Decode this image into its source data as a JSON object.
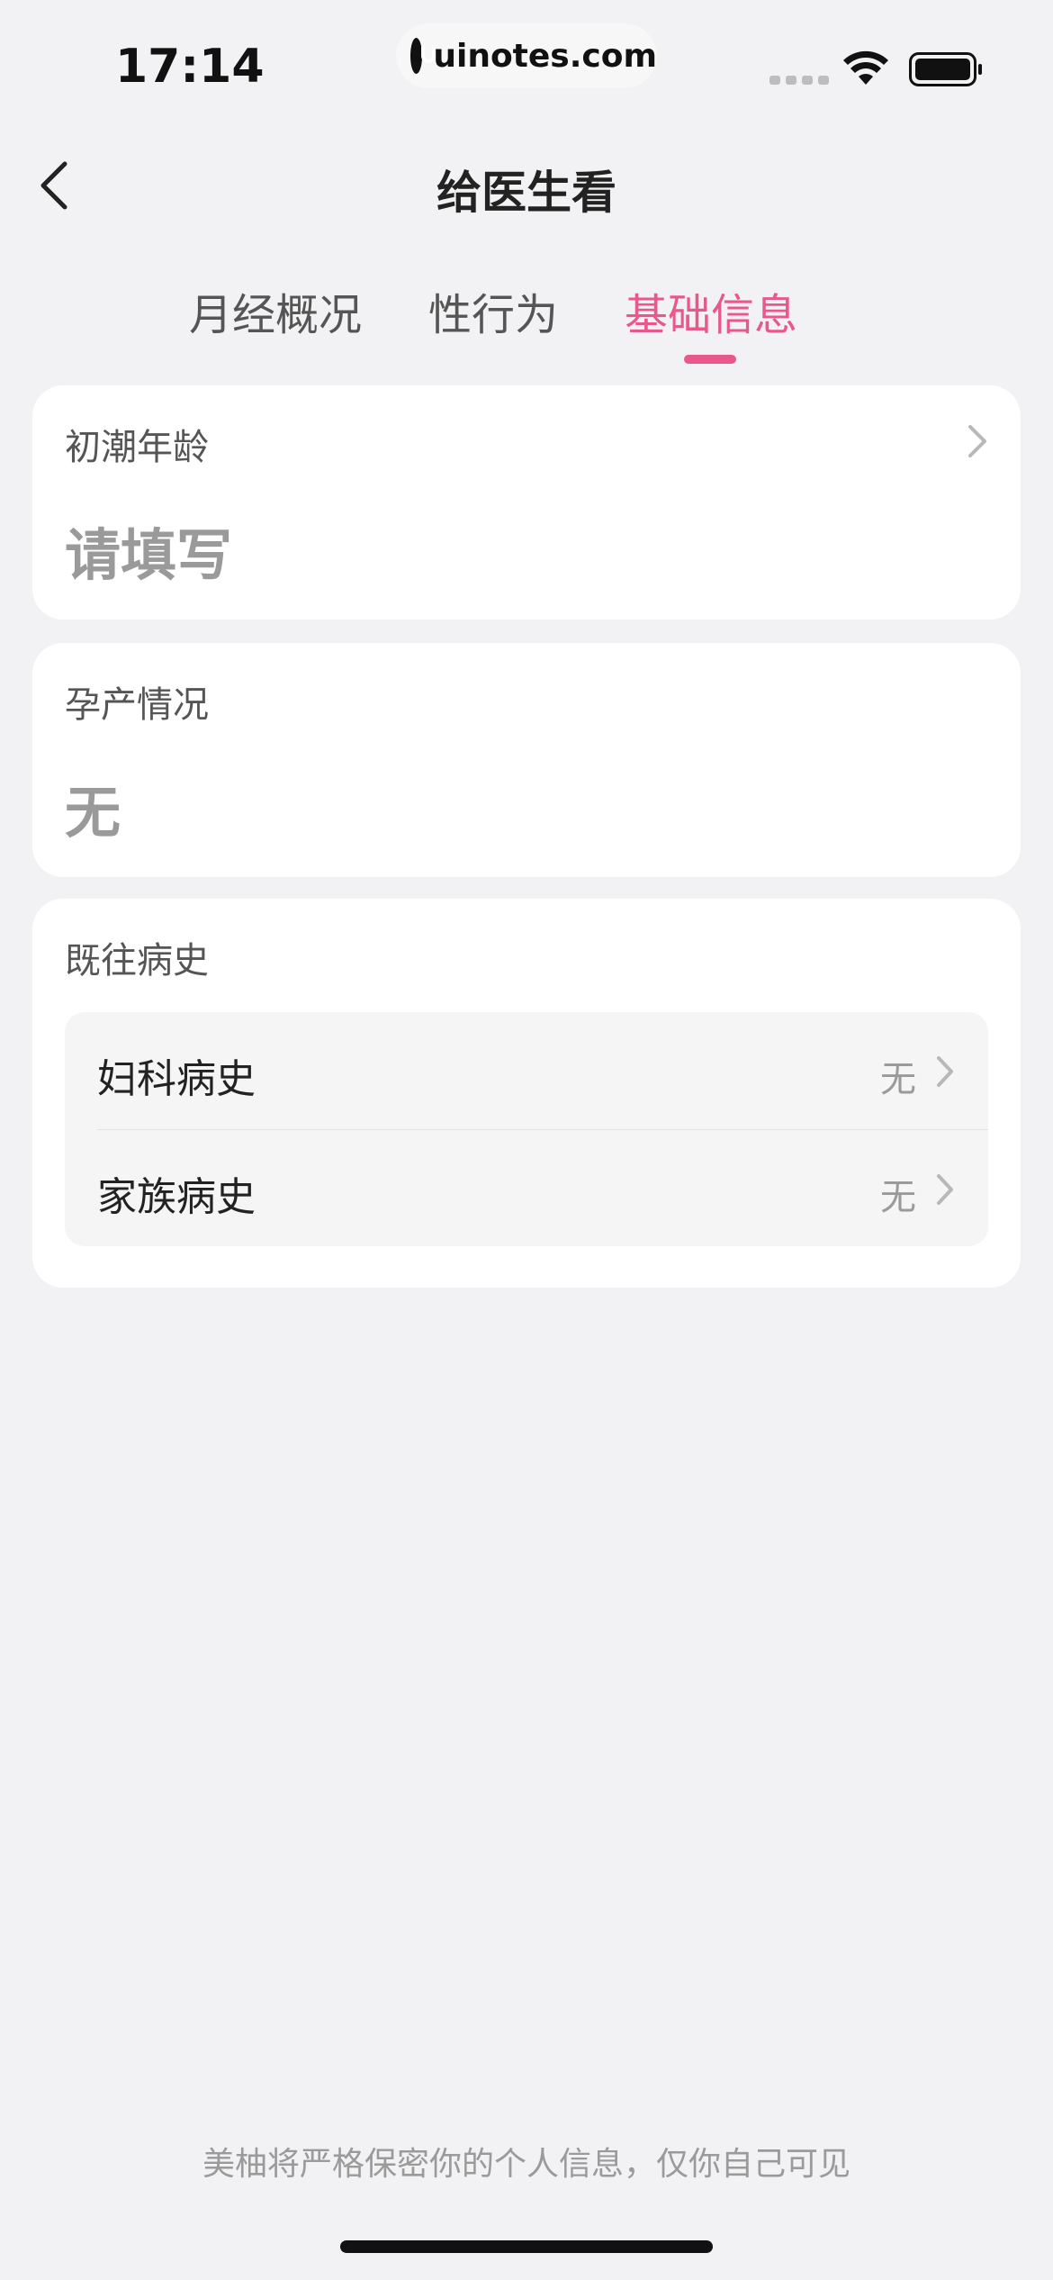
{
  "status_bar": {
    "time": "17:14",
    "url": "uinotes.com"
  },
  "header": {
    "title": "给医生看"
  },
  "tabs": [
    {
      "label": "月经概况",
      "active": false
    },
    {
      "label": "性行为",
      "active": false
    },
    {
      "label": "基础信息",
      "active": true
    }
  ],
  "menarche": {
    "label": "初潮年龄",
    "value": "请填写"
  },
  "pregnancy": {
    "label": "孕产情况",
    "value": "无"
  },
  "history": {
    "label": "既往病史",
    "rows": [
      {
        "label": "妇科病史",
        "value": "无"
      },
      {
        "label": "家族病史",
        "value": "无"
      }
    ]
  },
  "footer": {
    "note": "美柚将严格保密你的个人信息，仅你自己可见"
  },
  "colors": {
    "accent": "#E8588A",
    "background": "#F2F2F4",
    "card": "#FFFFFF",
    "muted_text": "#9A9A9A"
  }
}
